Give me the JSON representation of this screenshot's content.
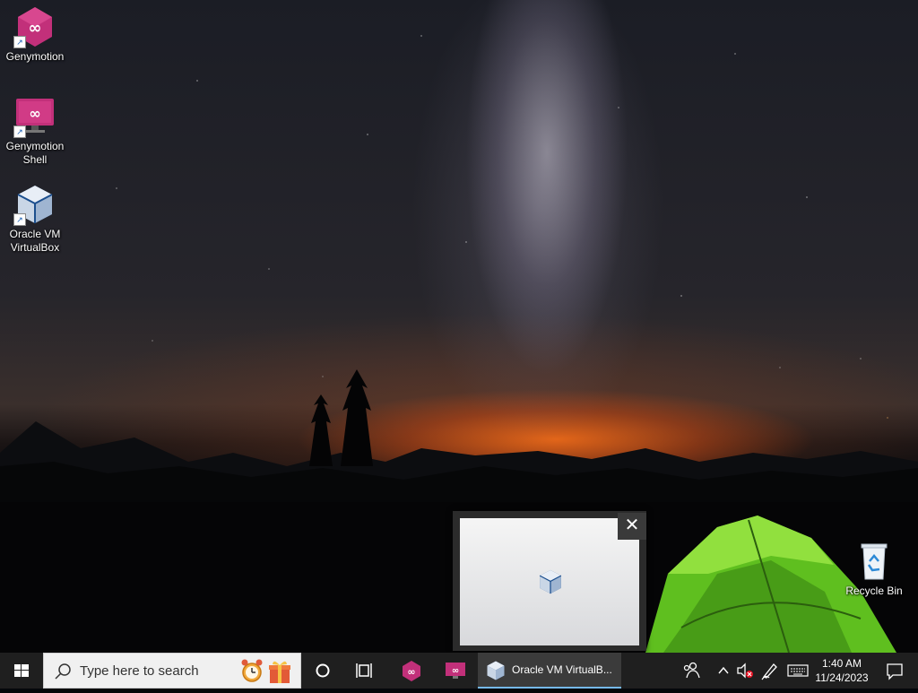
{
  "desktop": {
    "icons": [
      {
        "name": "genymotion",
        "label_line1": "Genymotion",
        "label_line2": ""
      },
      {
        "name": "genymotion-shell",
        "label_line1": "Genymotion",
        "label_line2": "Shell"
      },
      {
        "name": "oracle-vm-virtualbox",
        "label_line1": "Oracle VM",
        "label_line2": "VirtualBox"
      },
      {
        "name": "recycle-bin",
        "label_line1": "Recycle Bin",
        "label_line2": ""
      }
    ]
  },
  "preview": {
    "close_symbol": "✕",
    "app_icon": "virtualbox-icon"
  },
  "taskbar": {
    "search_placeholder": "Type here to search",
    "active_window_label": "Oracle VM VirtualB...",
    "pinned": [
      "cortana-icon",
      "task-view-icon",
      "genymotion-icon",
      "genymotion-shell-icon",
      "virtualbox-icon"
    ],
    "tray": {
      "time": "1:40 AM",
      "date": "11/24/2023"
    }
  },
  "colors": {
    "taskbar_bg": "#1f1f1f",
    "accent": "#76b9ed",
    "genymotion": "#c2307a"
  }
}
